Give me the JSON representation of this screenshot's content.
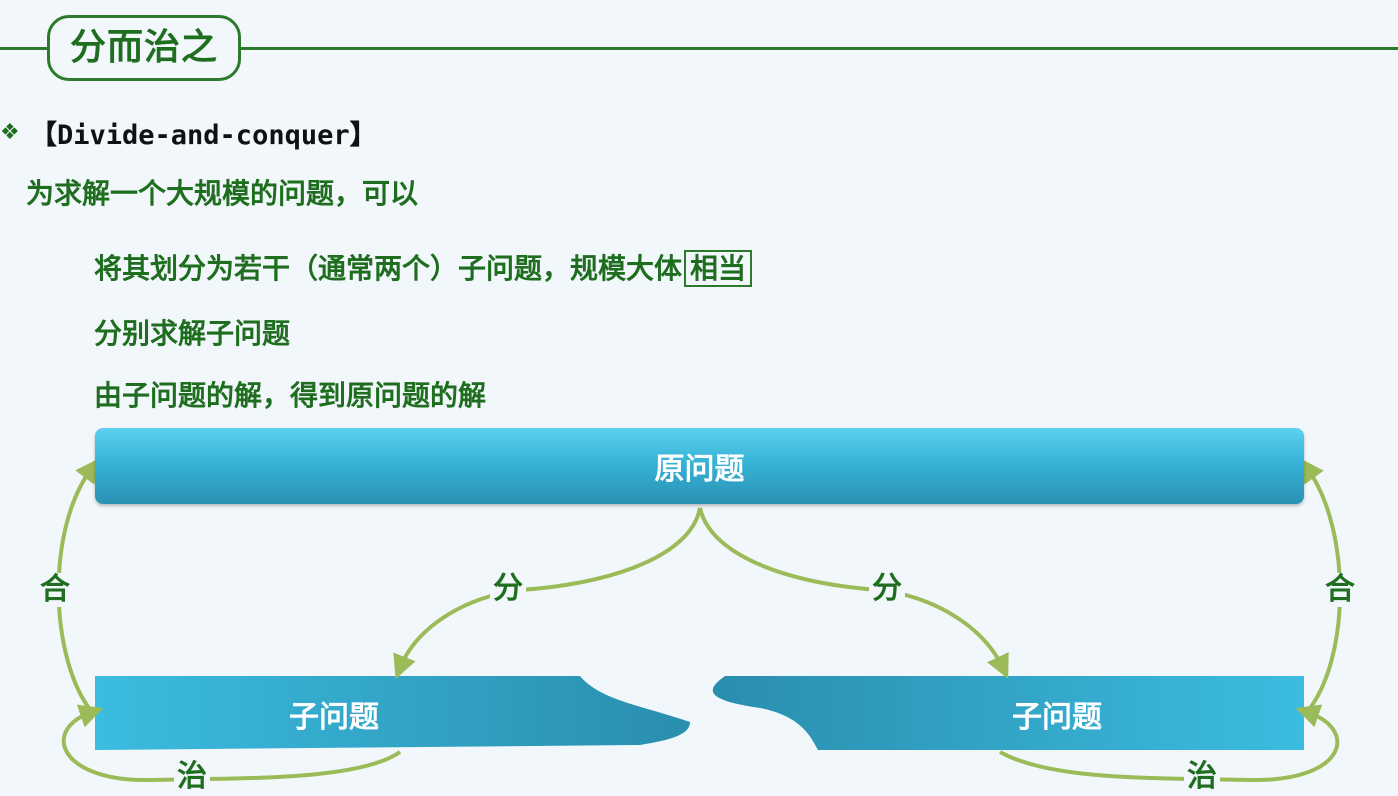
{
  "title": "分而治之",
  "bullet": {
    "icon": "❖",
    "text": "【Divide-and-conquer】"
  },
  "intro": "为求解一个大规模的问题，可以",
  "steps": {
    "step1_prefix": "将其划分为若干（通常两个）子问题，规模大体",
    "step1_highlight": "相当",
    "step2": "分别求解子问题",
    "step3": "由子问题的解，得到原问题的解"
  },
  "diagram": {
    "original": "原问题",
    "sub_left": "子问题",
    "sub_right": "子问题",
    "divide_left": "分",
    "divide_right": "分",
    "combine_left": "合",
    "combine_right": "合",
    "conquer_left": "治",
    "conquer_right": "治",
    "colors": {
      "box": "#37b3d8",
      "arrow": "#9bbb59",
      "text": "#1f6e1f"
    }
  }
}
